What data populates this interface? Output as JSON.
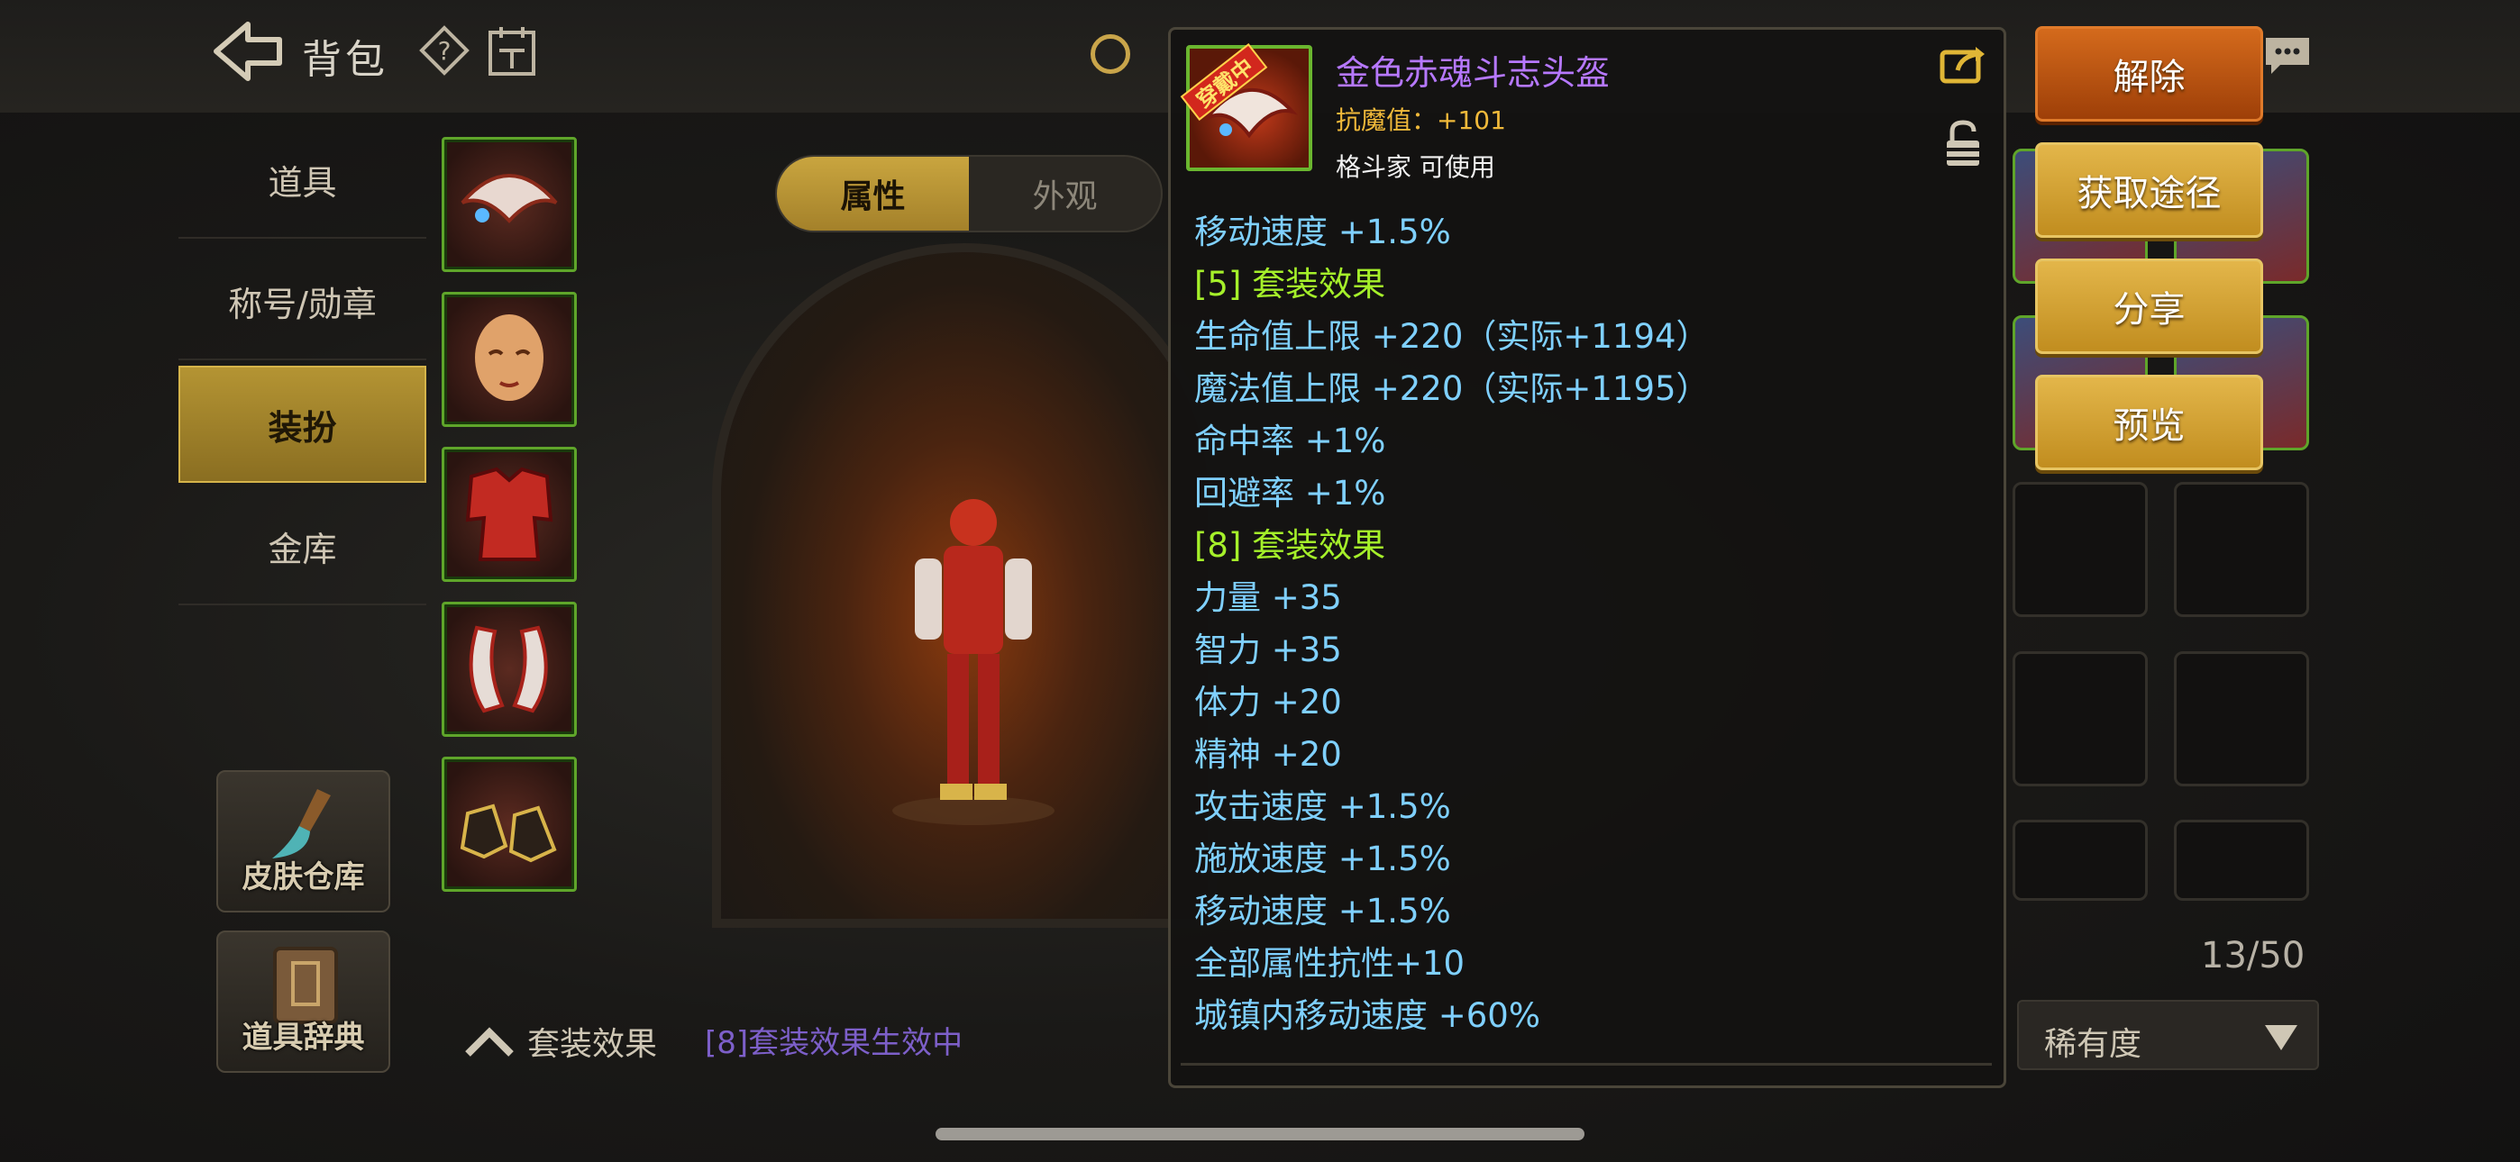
{
  "header": {
    "title": "背包"
  },
  "nav": {
    "items": [
      {
        "label": "道具"
      },
      {
        "label": "称号/勋章"
      },
      {
        "label": "装扮"
      },
      {
        "label": "金库"
      }
    ],
    "skin_warehouse": "皮肤仓库",
    "item_dictionary": "道具辞典"
  },
  "tabs": [
    {
      "label": "属性"
    },
    {
      "label": "外观"
    }
  ],
  "set_effect": {
    "label": "套装效果",
    "status": "[8]套装效果生效中"
  },
  "inventory": {
    "count": "13/50",
    "sort_label": "稀有度"
  },
  "actions": {
    "remove": "解除",
    "obtain": "获取途径",
    "share": "分享",
    "preview": "预览"
  },
  "tooltip": {
    "equipped_tag": "穿戴中",
    "name": "金色赤魂斗志头盔",
    "magic_resist": "抗魔值：+101",
    "usable_by": "格斗家 可使用",
    "stats": [
      {
        "text": "移动速度 +1.5%",
        "color": "blue"
      },
      {
        "text": "[5] 套装效果",
        "color": "green"
      },
      {
        "text": "生命值上限 +220（实际+1194）",
        "color": "blue"
      },
      {
        "text": "魔法值上限 +220（实际+1195）",
        "color": "blue"
      },
      {
        "text": "命中率 +1%",
        "color": "blue"
      },
      {
        "text": "回避率 +1%",
        "color": "blue"
      },
      {
        "text": "[8] 套装效果",
        "color": "green"
      },
      {
        "text": "力量 +35",
        "color": "blue"
      },
      {
        "text": "智力 +35",
        "color": "blue"
      },
      {
        "text": "体力 +20",
        "color": "blue"
      },
      {
        "text": "精神 +20",
        "color": "blue"
      },
      {
        "text": "攻击速度 +1.5%",
        "color": "blue"
      },
      {
        "text": "施放速度 +1.5%",
        "color": "blue"
      },
      {
        "text": "移动速度 +1.5%",
        "color": "blue"
      },
      {
        "text": "全部属性抗性+10",
        "color": "blue"
      },
      {
        "text": "城镇内移动速度 +60%",
        "color": "blue"
      }
    ]
  },
  "colors": {
    "accent_gold": "#c9a53f",
    "primary_orange": "#c2581a",
    "stat_blue": "#7fd0ff",
    "stat_green": "#a5f02a",
    "item_name_purple": "#b678ff"
  }
}
